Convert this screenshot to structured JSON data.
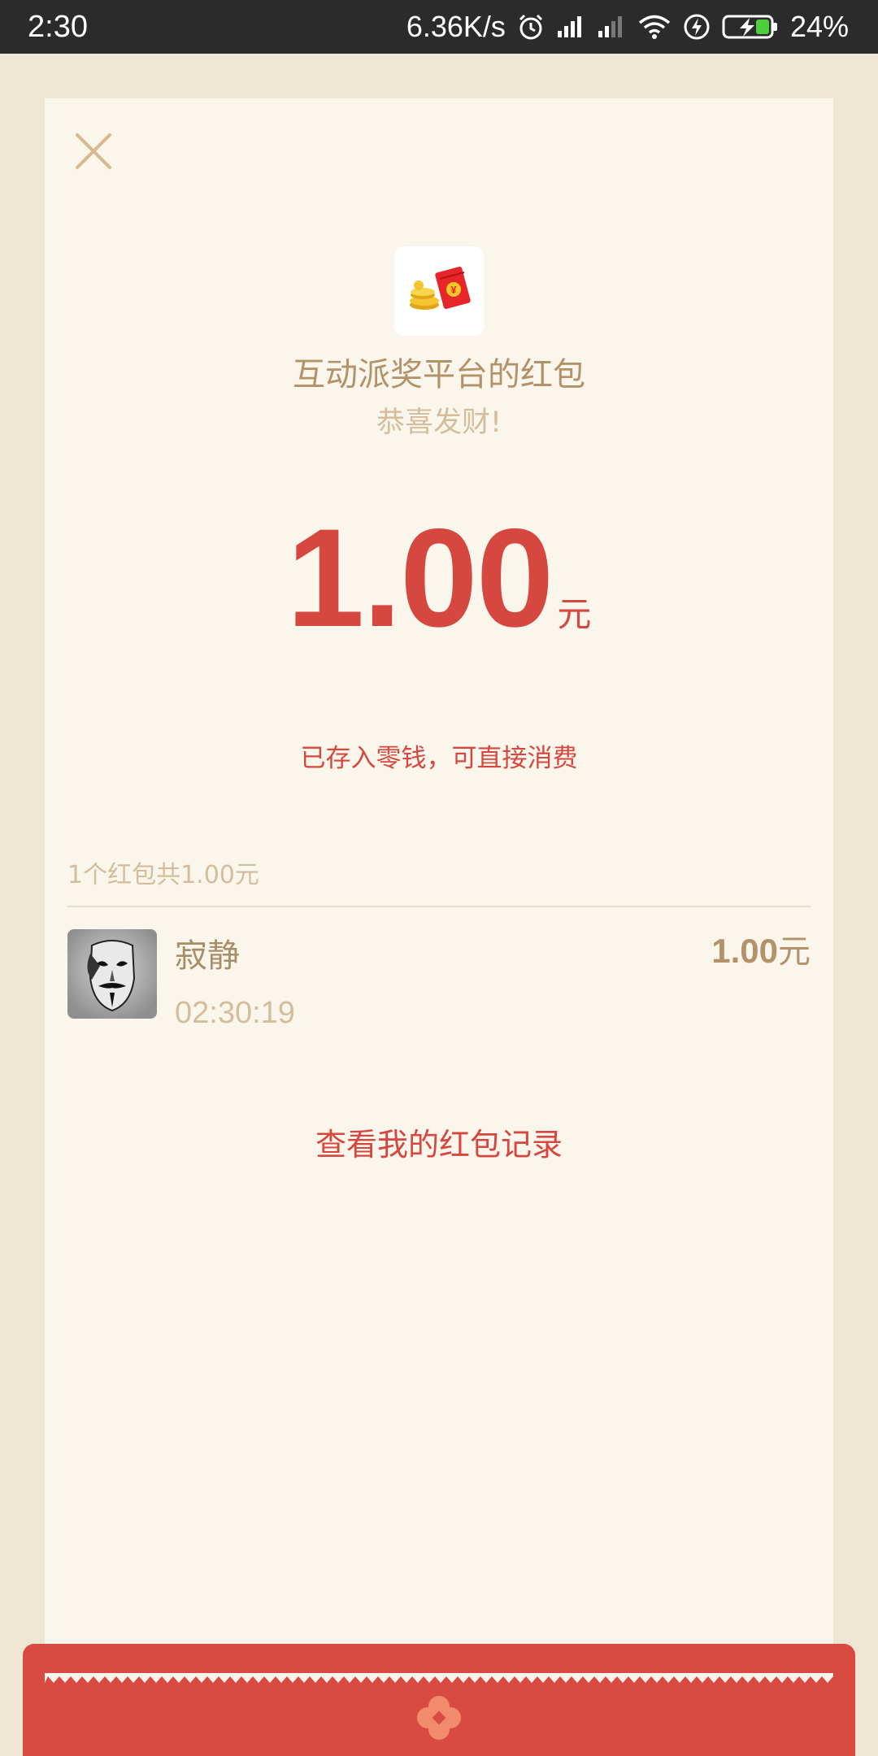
{
  "status_bar": {
    "time": "2:30",
    "network_speed": "6.36K/s",
    "battery": "24%",
    "icons": [
      "alarm-icon",
      "signal-icon",
      "signal-weak-icon",
      "wifi-icon",
      "charging-icon",
      "battery-icon"
    ]
  },
  "header": {
    "close_icon": "close-icon"
  },
  "packet": {
    "logo_icon": "red-packet-coins-icon",
    "sender_title": "互动派奖平台的红包",
    "wish": "恭喜发财!",
    "amount": "1.00",
    "unit": "元",
    "stored_note": "已存入零钱，可直接消费"
  },
  "summary": {
    "text": "1个红包共1.00元"
  },
  "receivers": [
    {
      "name": "寂静",
      "time": "02:30:19",
      "amount": "1.00",
      "unit": "元",
      "avatar_icon": "mask-avatar"
    }
  ],
  "actions": {
    "records_link": "查看我的红包记录"
  },
  "colors": {
    "accent_red": "#d6473f",
    "gold_text": "#b3926a",
    "light_gold_text": "#d4bd9c",
    "card_bg": "#faf6ec",
    "page_bg": "#efe6d4",
    "flap_red": "#d94b42"
  }
}
